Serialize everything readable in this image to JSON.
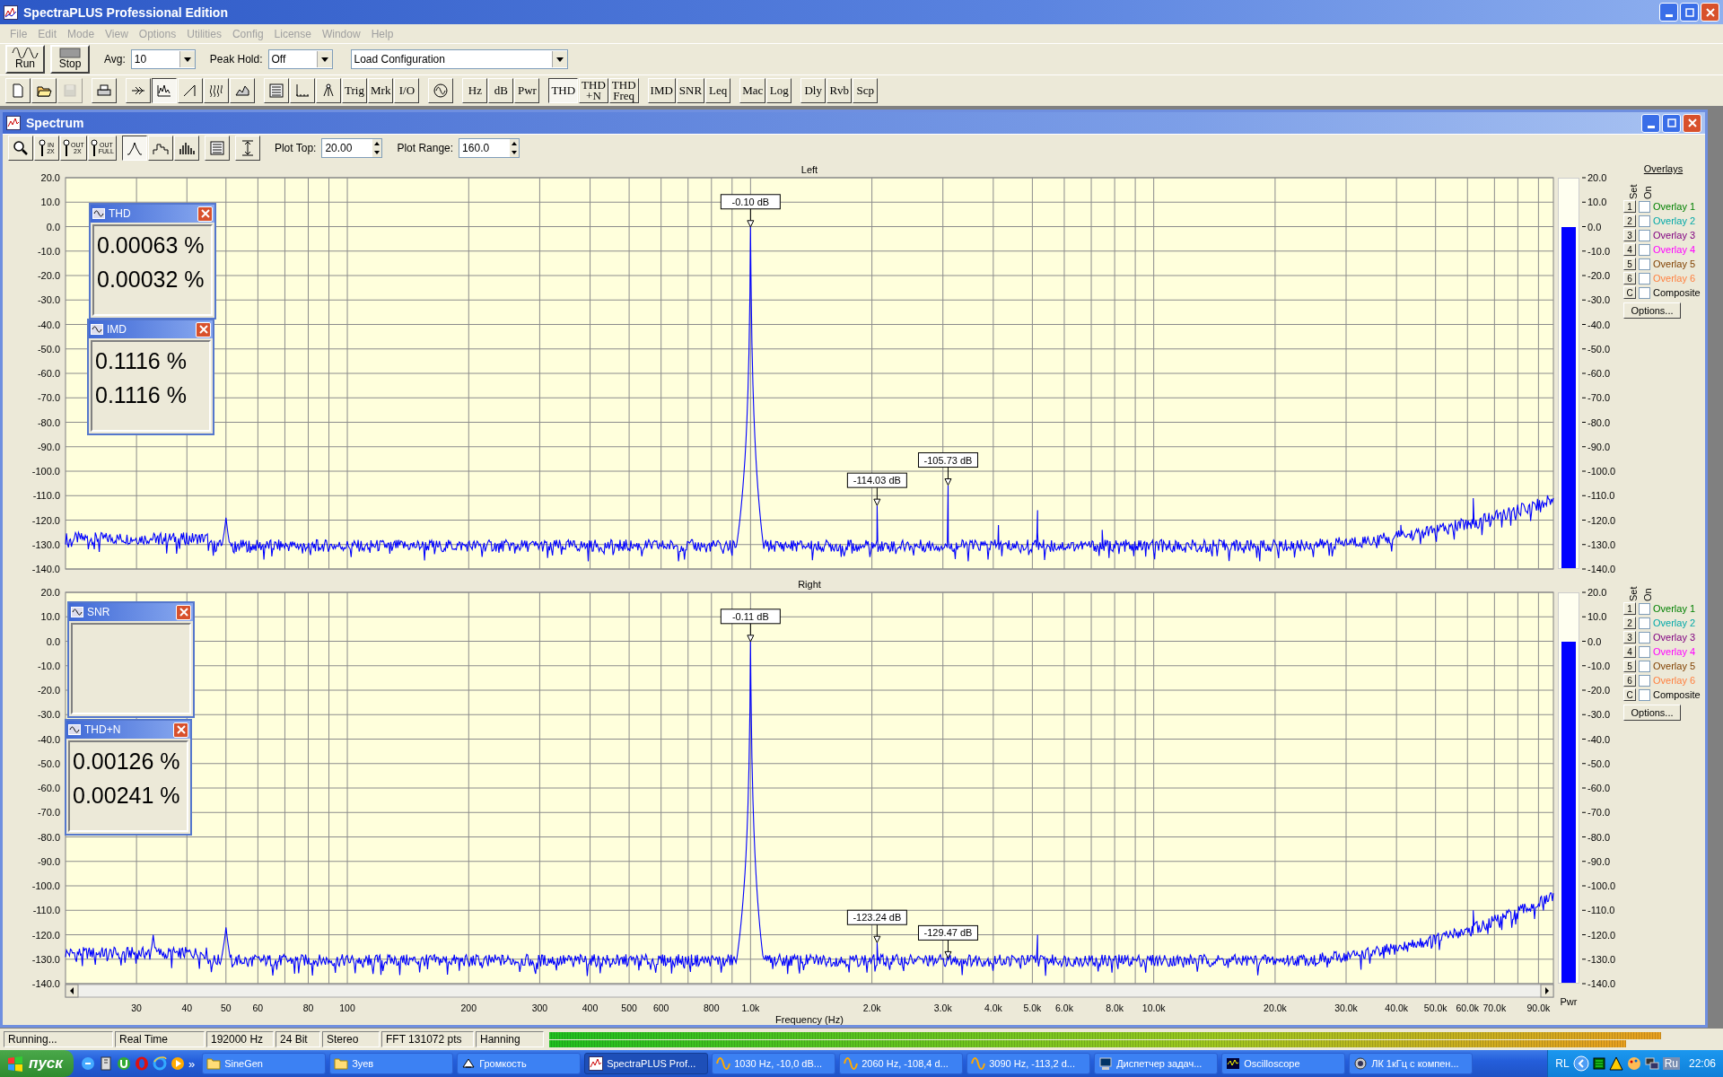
{
  "window": {
    "title": "SpectraPLUS Professional Edition"
  },
  "menu": [
    {
      "label": "File",
      "disabled": true
    },
    {
      "label": "Edit",
      "disabled": true
    },
    {
      "label": "Mode",
      "disabled": true
    },
    {
      "label": "View",
      "disabled": true
    },
    {
      "label": "Options",
      "disabled": true
    },
    {
      "label": "Utilities",
      "disabled": true
    },
    {
      "label": "Config",
      "disabled": true
    },
    {
      "label": "License",
      "disabled": true
    },
    {
      "label": "Window",
      "disabled": true
    },
    {
      "label": "Help",
      "disabled": true
    }
  ],
  "control_bar": {
    "run": "Run",
    "stop": "Stop",
    "avg": {
      "label": "Avg:",
      "value": "10"
    },
    "peak_hold": {
      "label": "Peak Hold:",
      "value": "Off"
    },
    "configuration": {
      "value": "Load Configuration"
    }
  },
  "toolbar": [
    [
      {
        "kind": "icon",
        "selected": false,
        "disabled": false
      },
      {
        "kind": "icon",
        "selected": false,
        "disabled": false
      },
      {
        "kind": "icon",
        "selected": false,
        "disabled": true
      }
    ],
    [
      {
        "kind": "icon",
        "selected": false,
        "disabled": false
      }
    ],
    [
      {
        "kind": "icon",
        "selected": false,
        "disabled": false
      },
      {
        "kind": "icon",
        "selected": true,
        "disabled": false
      },
      {
        "kind": "icon",
        "selected": false,
        "disabled": false
      },
      {
        "kind": "icon",
        "selected": false,
        "disabled": false
      },
      {
        "kind": "icon",
        "selected": false,
        "disabled": false
      }
    ],
    [
      {
        "kind": "icon",
        "selected": false,
        "disabled": false
      },
      {
        "kind": "icon",
        "selected": false,
        "disabled": false
      },
      {
        "kind": "icon",
        "selected": false,
        "disabled": false
      },
      {
        "kind": "text",
        "label": "Trig",
        "selected": false,
        "disabled": false
      },
      {
        "kind": "text",
        "label": "Mrk",
        "selected": false,
        "disabled": false
      },
      {
        "kind": "text",
        "label": "I/O",
        "selected": false,
        "disabled": false
      }
    ],
    [
      {
        "kind": "icon",
        "selected": false,
        "disabled": false
      }
    ],
    [
      {
        "kind": "text",
        "label": "Hz",
        "selected": false,
        "disabled": false
      },
      {
        "kind": "text",
        "label": "dB",
        "selected": false,
        "disabled": false
      },
      {
        "kind": "text",
        "label": "Pwr",
        "selected": false,
        "disabled": false
      }
    ],
    [
      {
        "kind": "text",
        "label": "THD",
        "selected": true,
        "disabled": false
      },
      {
        "kind": "text",
        "label": "THD\n+N",
        "selected": false,
        "disabled": false
      },
      {
        "kind": "text",
        "label": "THD\nFreq",
        "selected": false,
        "disabled": false
      }
    ],
    [
      {
        "kind": "text",
        "label": "IMD",
        "selected": false,
        "disabled": false
      },
      {
        "kind": "text",
        "label": "SNR",
        "selected": false,
        "disabled": false
      },
      {
        "kind": "text",
        "label": "Leq",
        "selected": false,
        "disabled": false
      }
    ],
    [
      {
        "kind": "text",
        "label": "Mac",
        "selected": false,
        "disabled": false
      },
      {
        "kind": "text",
        "label": "Log",
        "selected": false,
        "disabled": false
      }
    ],
    [
      {
        "kind": "text",
        "label": "Dly",
        "selected": false,
        "disabled": false
      },
      {
        "kind": "text",
        "label": "Rvb",
        "selected": false,
        "disabled": false
      },
      {
        "kind": "text",
        "label": "Scp",
        "selected": false,
        "disabled": false
      }
    ]
  ],
  "spectrum_window": {
    "title": "Spectrum",
    "zoom_buttons": [
      {
        "kind": "icon"
      },
      {
        "kind": "caption",
        "caption": "IN\n2X"
      },
      {
        "kind": "caption",
        "caption": "OUT\n2X"
      },
      {
        "kind": "caption",
        "caption": "OUT\nFULL"
      }
    ],
    "view_buttons": [
      {
        "selected": true
      },
      {
        "selected": false
      },
      {
        "selected": false
      }
    ],
    "plot_top": {
      "label": "Plot Top:",
      "value": "20.00"
    },
    "plot_range": {
      "label": "Plot Range:",
      "value": "160.0"
    },
    "channels": [
      {
        "title": "Left",
        "y_labels": [
          "20.0",
          "10.0",
          "0.0",
          "-10.0",
          "-20.0",
          "-30.0",
          "-40.0",
          "-50.0",
          "-60.0",
          "-70.0",
          "-80.0",
          "-90.0",
          "-100.0",
          "-110.0",
          "-120.0",
          "-130.0",
          "-140.0"
        ],
        "markers": [
          {
            "text": "-0.10 dB"
          },
          {
            "text": "-114.03 dB"
          },
          {
            "text": "-105.73 dB"
          }
        ],
        "meter": {
          "level": 0.875,
          "scale": [
            "20.0",
            "10.0",
            "0.0",
            "-10.0",
            "-20.0",
            "-30.0",
            "-40.0",
            "-50.0",
            "-60.0",
            "-70.0",
            "-80.0",
            "-90.0",
            "-100.0",
            "-110.0",
            "-120.0",
            "-130.0",
            "-140.0"
          ]
        },
        "overlays": {
          "heading": "Overlays",
          "set_label": "Set",
          "on_label": "On",
          "options": "Options...",
          "rows": [
            {
              "key": "1",
              "label": "Overlay 1",
              "color": "#008000",
              "checked": false
            },
            {
              "key": "2",
              "label": "Overlay 2",
              "color": "#00a8a8",
              "checked": false
            },
            {
              "key": "3",
              "label": "Overlay 3",
              "color": "#800080",
              "checked": false
            },
            {
              "key": "4",
              "label": "Overlay 4",
              "color": "#ff00ff",
              "checked": false
            },
            {
              "key": "5",
              "label": "Overlay 5",
              "color": "#804000",
              "checked": false
            },
            {
              "key": "6",
              "label": "Overlay 6",
              "color": "#ff8040",
              "checked": false
            },
            {
              "key": "C",
              "label": "Composite",
              "color": "#000000",
              "checked": false
            }
          ]
        },
        "readouts": [
          {
            "title": "THD",
            "values": [
              "0.00063 %",
              "0.00032 %"
            ]
          },
          {
            "title": "IMD",
            "values": [
              "0.1116 %",
              "0.1116 %"
            ]
          }
        ]
      },
      {
        "title": "Right",
        "y_labels": [
          "20.0",
          "10.0",
          "0.0",
          "-10.0",
          "-20.0",
          "-30.0",
          "-40.0",
          "-50.0",
          "-60.0",
          "-70.0",
          "-80.0",
          "-90.0",
          "-100.0",
          "-110.0",
          "-120.0",
          "-130.0",
          "-140.0"
        ],
        "x_labels": [
          "30",
          "40",
          "50",
          "60",
          "80",
          "100",
          "200",
          "300",
          "400",
          "500",
          "600",
          "800",
          "1.0k",
          "2.0k",
          "3.0k",
          "4.0k",
          "5.0k",
          "6.0k",
          "8.0k",
          "10.0k",
          "20.0k",
          "30.0k",
          "40.0k",
          "50.0k",
          "60.0k",
          "70.0k",
          "90.0k"
        ],
        "x_title": "Frequency (Hz)",
        "markers": [
          {
            "text": "-0.11 dB"
          },
          {
            "text": "-123.24 dB"
          },
          {
            "text": "-129.47 dB"
          }
        ],
        "meter": {
          "level": 0.875,
          "scale": [
            "20.0",
            "10.0",
            "0.0",
            "-10.0",
            "-20.0",
            "-30.0",
            "-40.0",
            "-50.0",
            "-60.0",
            "-70.0",
            "-80.0",
            "-90.0",
            "-100.0",
            "-110.0",
            "-120.0",
            "-130.0",
            "-140.0"
          ],
          "caption": "Pwr"
        },
        "overlays": {
          "set_label": "Set",
          "on_label": "On",
          "options": "Options...",
          "rows": [
            {
              "key": "1",
              "label": "Overlay 1",
              "color": "#008000",
              "checked": false
            },
            {
              "key": "2",
              "label": "Overlay 2",
              "color": "#00a8a8",
              "checked": false
            },
            {
              "key": "3",
              "label": "Overlay 3",
              "color": "#800080",
              "checked": false
            },
            {
              "key": "4",
              "label": "Overlay 4",
              "color": "#ff00ff",
              "checked": false
            },
            {
              "key": "5",
              "label": "Overlay 5",
              "color": "#804000",
              "checked": false
            },
            {
              "key": "6",
              "label": "Overlay 6",
              "color": "#ff8040",
              "checked": false
            },
            {
              "key": "C",
              "label": "Composite",
              "color": "#000000",
              "checked": false
            }
          ]
        },
        "readouts": [
          {
            "title": "SNR"
          },
          {
            "title": "THD+N",
            "values": [
              "0.00126 %",
              "0.00241 %"
            ]
          }
        ]
      }
    ]
  },
  "status_bar": {
    "fields": [
      "Running...",
      "Real Time",
      "192000 Hz",
      "24 Bit",
      "Stereo",
      "FFT 131072 pts",
      "Hanning"
    ],
    "input_levels": [
      {
        "level": 0.95
      },
      {
        "level": 0.92
      }
    ]
  },
  "taskbar": {
    "start": "пуск",
    "quick_launch_more": "»",
    "tasks": [
      {
        "label": "SineGen",
        "selected": false
      },
      {
        "label": "Зуев",
        "selected": false
      },
      {
        "label": "Громкость",
        "selected": false
      },
      {
        "label": "SpectraPLUS Prof...",
        "selected": true
      },
      {
        "label": "1030 Hz, -10,0 dB...",
        "selected": false
      },
      {
        "label": "2060 Hz, -108,4 d...",
        "selected": false
      },
      {
        "label": "3090 Hz, -113,2 d...",
        "selected": false
      },
      {
        "label": "Диспетчер задач...",
        "selected": false
      },
      {
        "label": "Oscilloscope",
        "selected": false
      },
      {
        "label": "ЛК 1кГц с компен...",
        "selected": false
      }
    ],
    "tray": {
      "language_bar": "RL",
      "language": "Ru",
      "clock": "22:06"
    }
  }
}
